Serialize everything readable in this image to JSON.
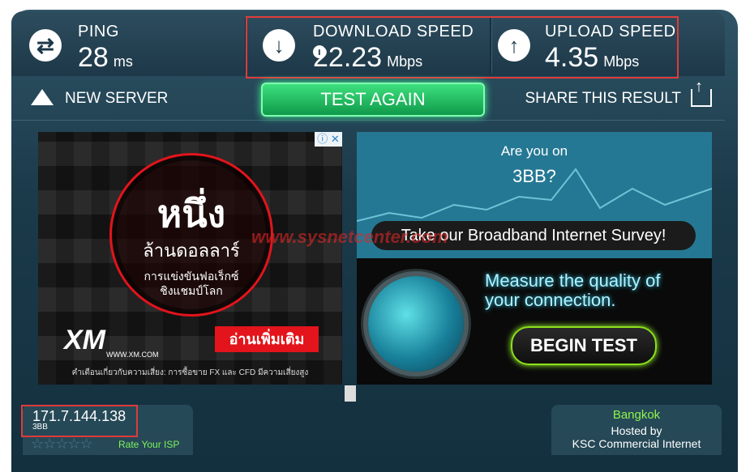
{
  "stats": {
    "ping": {
      "label": "PING",
      "value": "28",
      "unit": "ms"
    },
    "download": {
      "label": "DOWNLOAD SPEED",
      "value": "22.23",
      "unit": "Mbps"
    },
    "upload": {
      "label": "UPLOAD SPEED",
      "value": "4.35",
      "unit": "Mbps"
    }
  },
  "actions": {
    "new_server": "NEW SERVER",
    "test_again": "TEST AGAIN",
    "share": "SHARE THIS RESULT"
  },
  "ad": {
    "headline": "หนึ่ง",
    "subhead": "ล้านดอลลาร์",
    "desc1": "การแข่งขันฟอเร็กซ์",
    "desc2": "ชิงแชมป์โลก",
    "brand": "XM",
    "brand_site": "WWW.XM.COM",
    "cta": "อ่านเพิ่มเติม",
    "disclaimer": "คำเตือนเกี่ยวกับความเสี่ยง: การซื้อขาย FX และ CFD มีความเสี่ยงสูง",
    "close": "ⓘ ✕"
  },
  "survey": {
    "q1": "Are you on",
    "q2": "3BB?",
    "survey_text": "Take our Broadband Internet Survey!",
    "measure1": "Measure the quality of",
    "measure2": "your connection.",
    "begin": "BEGIN TEST"
  },
  "footer": {
    "ip": "171.7.144.138",
    "isp": "3BB",
    "stars": "☆☆☆☆☆",
    "rate": "Rate Your ISP",
    "city": "Bangkok",
    "hosted_by": "Hosted by",
    "host": "KSC Commercial Internet"
  },
  "watermark": "www.sysnetcenter.com",
  "colors": {
    "accent_green": "#3de07e",
    "highlight_red": "#e03b3b"
  }
}
